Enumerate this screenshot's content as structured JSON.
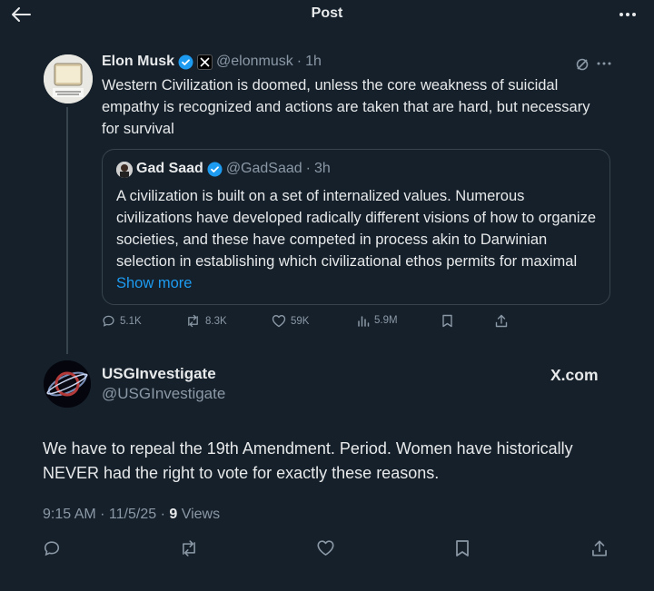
{
  "header": {
    "title": "Post"
  },
  "tweet": {
    "author": "Elon Musk",
    "handle": "@elonmusk",
    "separator": "·",
    "time": "1h",
    "text": "Western Civilization is doomed, unless the core weakness of suicidal empathy is recognized and actions are taken that are hard, but necessary for survival",
    "quote": {
      "author": "Gad Saad",
      "handle": "@GadSaad",
      "separator": "·",
      "time": "3h",
      "text": "A civilization is built on a set of internalized values.  Numerous civilizations have developed radically different visions of how to organize societies, and these have competed in process akin to Darwinian selection in establishing which civilizational ethos permits for maximal ",
      "show_more": "Show more"
    },
    "actions": {
      "replies": "5.1K",
      "reposts": "8.3K",
      "likes": "59K",
      "views": "5.9M"
    }
  },
  "reply": {
    "author": "USGInvestigate",
    "handle": "@USGInvestigate",
    "source": "X.com",
    "text": "We have to repeal the 19th Amendment. Period. Women have historically NEVER had the right to vote for exactly these reasons.",
    "timestamp": "9:15 AM · 11/5/25 · ",
    "views_count": "9",
    "views_label": " Views"
  },
  "colors": {
    "background": "#15202b",
    "text": "#e7e9ea",
    "muted": "#8b98a5",
    "accent": "#1d9bf0",
    "verified": "#1d9bf0",
    "border": "#38444d"
  },
  "icons": [
    "back-arrow-icon",
    "more-icon",
    "verified-badge-icon",
    "x-logo-icon",
    "grok-icon",
    "reply-icon",
    "repost-icon",
    "like-icon",
    "views-icon",
    "bookmark-icon",
    "share-icon"
  ]
}
